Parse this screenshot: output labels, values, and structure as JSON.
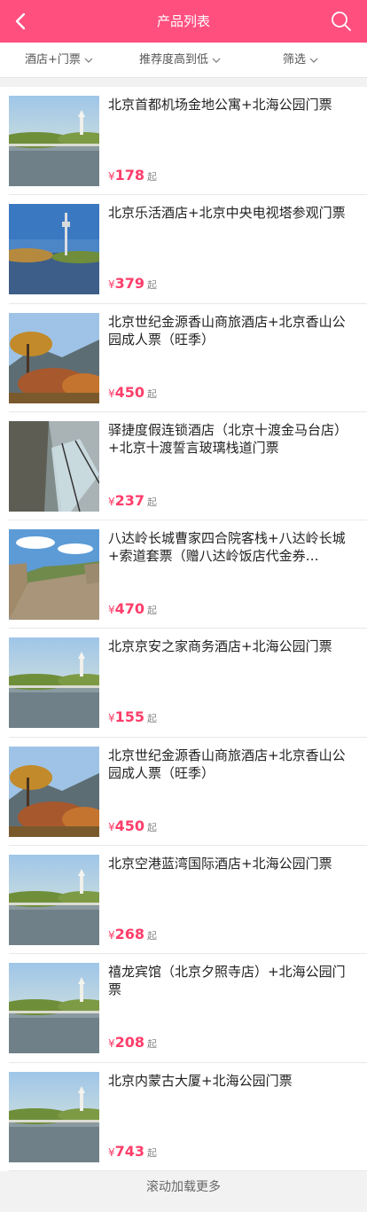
{
  "header": {
    "title": "产品列表",
    "back_icon": "back-arrow-icon",
    "search_icon": "search-icon"
  },
  "filters": [
    {
      "label": "酒店+门票"
    },
    {
      "label": "推荐度高到低"
    },
    {
      "label": "筛选"
    }
  ],
  "colors": {
    "brand": "#fe4f7f",
    "price": "#fe3e6a"
  },
  "products": [
    {
      "name": "北京首都机场金地公寓+北海公园门票",
      "currency": "¥",
      "price": "178",
      "unit": "起",
      "image": "beihai-park-photo"
    },
    {
      "name": "北京乐活酒店+北京中央电视塔参观门票",
      "currency": "¥",
      "price": "379",
      "unit": "起",
      "image": "cctv-tower-photo"
    },
    {
      "name": "北京世纪金源香山商旅酒店+北京香山公园成人票（旺季）",
      "currency": "¥",
      "price": "450",
      "unit": "起",
      "image": "fragrant-hills-photo"
    },
    {
      "name": "驿捷度假连锁酒店（北京十渡金马台店）+北京十渡誓言玻璃栈道门票",
      "currency": "¥",
      "price": "237",
      "unit": "起",
      "image": "glass-walkway-photo"
    },
    {
      "name": "八达岭长城曹家四合院客栈+八达岭长城+索道套票（赠八达岭饭店代金券…",
      "currency": "¥",
      "price": "470",
      "unit": "起",
      "image": "great-wall-photo"
    },
    {
      "name": "北京京安之家商务酒店+北海公园门票",
      "currency": "¥",
      "price": "155",
      "unit": "起",
      "image": "beihai-park-photo"
    },
    {
      "name": "北京世纪金源香山商旅酒店+北京香山公园成人票（旺季）",
      "currency": "¥",
      "price": "450",
      "unit": "起",
      "image": "fragrant-hills-photo"
    },
    {
      "name": "北京空港蓝湾国际酒店+北海公园门票",
      "currency": "¥",
      "price": "268",
      "unit": "起",
      "image": "beihai-park-photo"
    },
    {
      "name": "禧龙宾馆（北京夕照寺店）+北海公园门票",
      "currency": "¥",
      "price": "208",
      "unit": "起",
      "image": "beihai-park-photo"
    },
    {
      "name": "北京内蒙古大厦+北海公园门票",
      "currency": "¥",
      "price": "743",
      "unit": "起",
      "image": "beihai-park-photo"
    }
  ],
  "footer": {
    "load_more": "滚动加载更多"
  }
}
